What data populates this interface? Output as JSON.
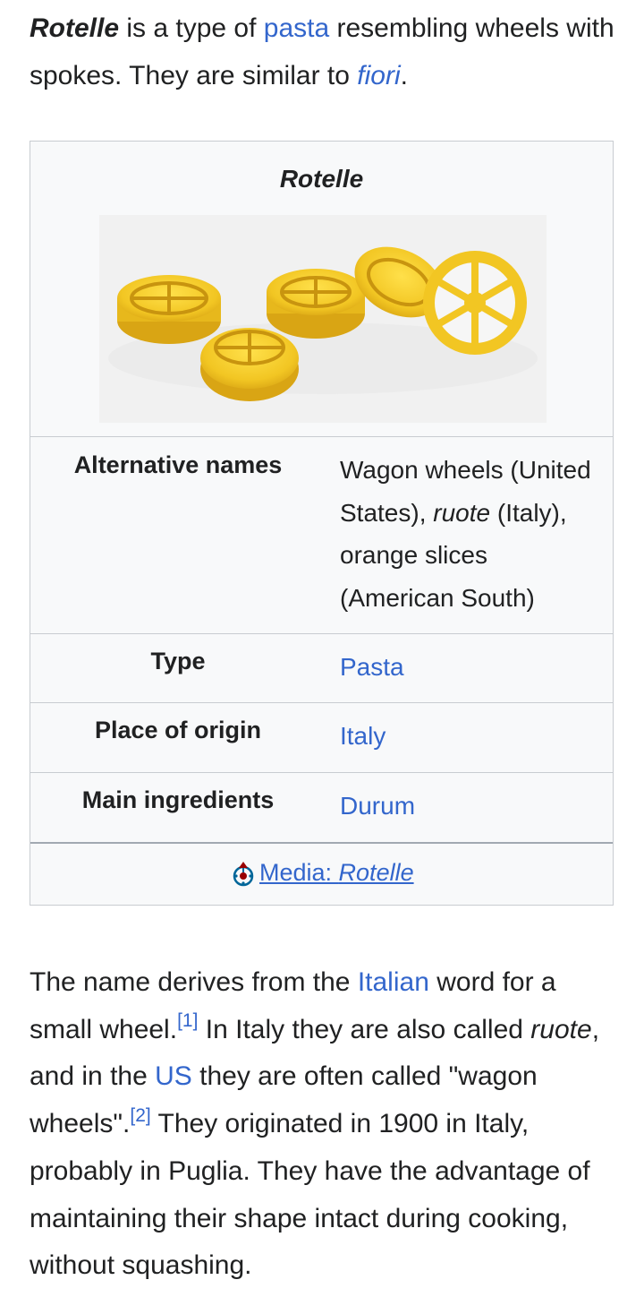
{
  "intro": {
    "term": "Rotelle",
    "t1": " is a type of ",
    "link_pasta": "pasta",
    "t2": " resembling wheels with spokes. They are similar to ",
    "link_fiori": "fiori",
    "t3": "."
  },
  "infobox": {
    "title": "Rotelle",
    "rows": [
      {
        "label": "Alternative names",
        "v1": "Wagon wheels (United States), ",
        "v_italic": "ruote",
        "v2": " (Italy), orange slices (American South)"
      },
      {
        "label": "Type",
        "value": "Pasta"
      },
      {
        "label": "Place of origin",
        "value": "Italy"
      },
      {
        "label": "Main ingredients",
        "value": "Durum"
      }
    ],
    "media_prefix": "Media: ",
    "media_title": "Rotelle"
  },
  "body": {
    "t1": "The name derives from the ",
    "link_italian": "Italian",
    "t2": " word for a small wheel.",
    "ref1": "[1]",
    "t3": " In Italy they are also called ",
    "ruote": "ruote",
    "t4": ", and in the ",
    "link_us": "US",
    "t5": " they are often called \"wagon wheels\".",
    "ref2": "[2]",
    "t6": " They originated in 1900 in Italy, probably in Puglia. They have the advantage of maintaining their shape intact during cooking, without squashing."
  },
  "colors": {
    "link": "#3366cc",
    "text": "#202122",
    "infobox_bg": "#f8f9fa",
    "border": "#c8ccd1",
    "pasta": "#f2c623"
  }
}
